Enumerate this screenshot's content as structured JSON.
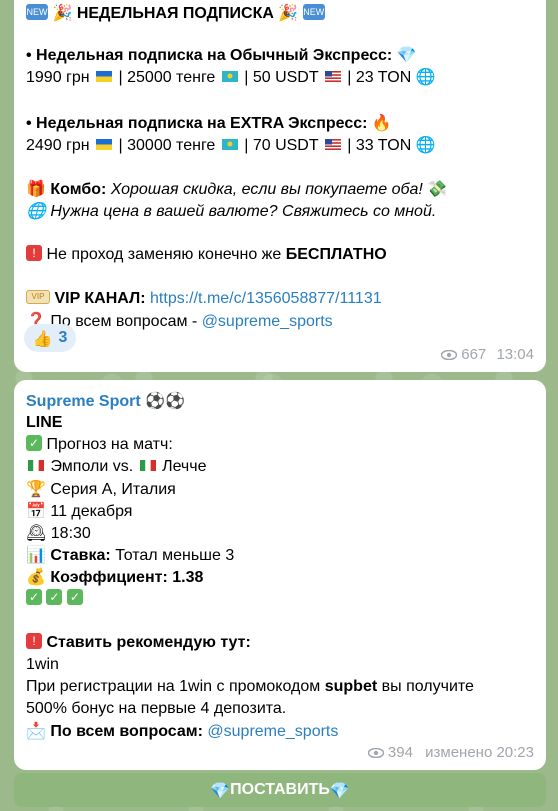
{
  "post1": {
    "title": "НЕДЕЛЬНАЯ ПОДПИСКА",
    "regular_label": "• Недельная подписка на Обычный Экспресс:",
    "regular_prices": [
      "1990 грн",
      "| 25000 тенге",
      "| 50 USDT",
      "| 23 TON"
    ],
    "extra_label": "• Недельная подписка на EXTRA Экспресс:",
    "extra_prices": [
      "2490 грн",
      "| 30000 тенге",
      "| 70 USDT",
      "| 33 TON"
    ],
    "combo_label": "Комбо:",
    "combo_text": "Хорошая скидка, если вы покупаете оба!",
    "currency_text": "Нужна цена в вашей валюте? Свяжитесь со мной.",
    "replace_text": "Не проход заменяю конечно же",
    "replace_bold": "БЕСПЛАТНО",
    "vip_label": "VIP КАНАЛ:",
    "vip_link": "https://t.me/c/1356058877/11131",
    "questions_label": "По всем вопросам -",
    "questions_link": "@supreme_sports",
    "reaction_count": "3",
    "views": "667",
    "time": "13:04"
  },
  "post2": {
    "sender": "Supreme Sport",
    "line": "LINE",
    "forecast_label": "Прогноз на матч:",
    "match_home": "Эмполи vs.",
    "match_away": "Лечче",
    "league": "Серия А, Италия",
    "date": "11 декабря",
    "time_of_match": "18:30",
    "bet_label": "Ставка:",
    "bet_value": "Тотал меньше 3",
    "coef_label": "Коэффициент:",
    "coef_value": "1.38",
    "recommend_label": "Ставить рекомендую тут:",
    "bookmaker": "1win",
    "promo_pre": "При регистрации на 1win с промокодом",
    "promo_code": "supbet",
    "promo_post": "вы получите",
    "promo_line2": "500% бонус на первые 4 депозита.",
    "questions_label": "По всем вопросам:",
    "questions_link": "@supreme_sports",
    "views": "394",
    "edited_time": "изменено 20:23"
  },
  "button": {
    "label": "ПОСТАВИТЬ"
  },
  "colors": {
    "link": "#2a7fc1",
    "background": "#9bb98a",
    "button": "#8fb67c"
  }
}
